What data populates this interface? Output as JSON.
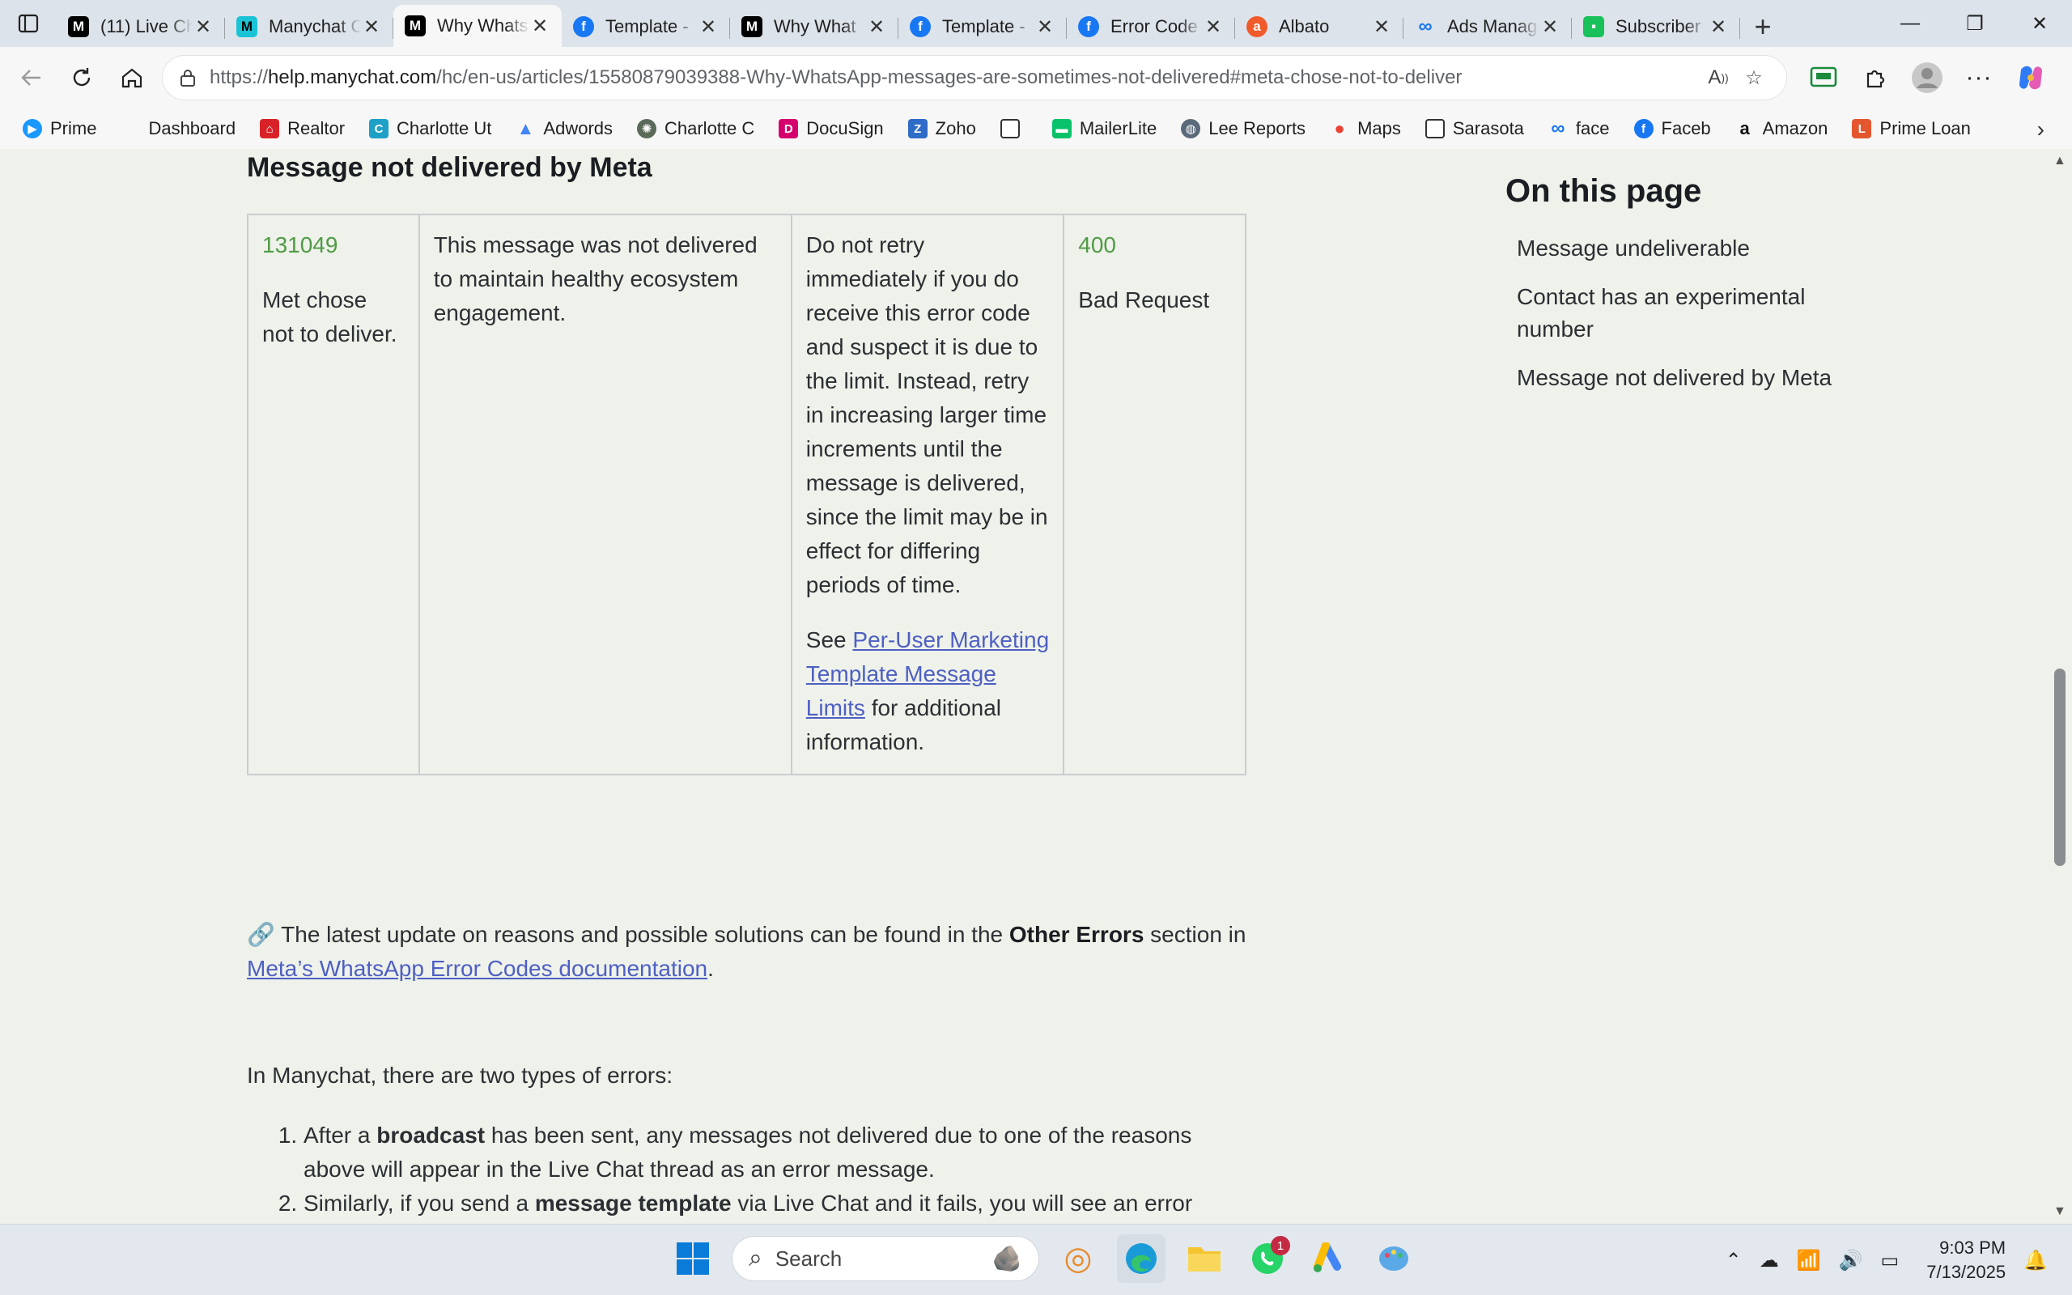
{
  "browser": {
    "tabs": [
      {
        "title": "(11) Live Ch",
        "icon": "manychat-m-icon",
        "active": false
      },
      {
        "title": "Manychat C",
        "icon": "manychat-teal-icon",
        "active": false
      },
      {
        "title": "Why Whats",
        "icon": "manychat-m-icon",
        "active": true
      },
      {
        "title": "Template -",
        "icon": "facebook-icon",
        "active": false
      },
      {
        "title": "Why What",
        "icon": "manychat-m-icon",
        "active": false
      },
      {
        "title": "Template -",
        "icon": "facebook-icon",
        "active": false
      },
      {
        "title": "Error Code",
        "icon": "facebook-icon",
        "active": false
      },
      {
        "title": "Albato",
        "icon": "albato-icon",
        "active": false
      },
      {
        "title": "Ads Manag",
        "icon": "meta-icon",
        "active": false
      },
      {
        "title": "Subscriber",
        "icon": "chat-green-icon",
        "active": false
      }
    ],
    "url_prefix": "https://",
    "url_host": "help.manychat.com",
    "url_path": "/hc/en-us/articles/15580879039388-Why-WhatsApp-messages-are-sometimes-not-delivered#meta-chose-not-to-deliver",
    "bookmarks": [
      {
        "label": "Prime",
        "icon": "prime-icon",
        "color": "#1a98ff"
      },
      {
        "label": "Dashboard",
        "icon": "dashboard-icon",
        "color": "#ffffff"
      },
      {
        "label": "Realtor",
        "icon": "realtor-icon",
        "color": "#d92228"
      },
      {
        "label": "Charlotte Ut",
        "icon": "charlotte-icon",
        "color": "#1fa0c7"
      },
      {
        "label": "Adwords",
        "icon": "adwords-icon",
        "color": "#4285f4"
      },
      {
        "label": "Charlotte C",
        "icon": "seal-icon",
        "color": "#5a6b5a"
      },
      {
        "label": "DocuSign",
        "icon": "docusign-icon",
        "color": "#d5006d"
      },
      {
        "label": "Zoho",
        "icon": "zoho-icon",
        "color": "#2f6cc8"
      },
      {
        "label": "",
        "icon": "page-icon",
        "color": "#ffffff"
      },
      {
        "label": "MailerLite",
        "icon": "mailerlite-icon",
        "color": "#09c269"
      },
      {
        "label": "Lee Reports",
        "icon": "globe-icon",
        "color": "#5b6a7a"
      },
      {
        "label": "Maps",
        "icon": "maps-icon",
        "color": "#34a853"
      },
      {
        "label": "Sarasota",
        "icon": "page-icon",
        "color": "#ffffff"
      },
      {
        "label": "face",
        "icon": "meta-icon",
        "color": "#1877f2"
      },
      {
        "label": "Faceb",
        "icon": "facebook-icon",
        "color": "#1877f2"
      },
      {
        "label": "Amazon",
        "icon": "amazon-icon",
        "color": "#111111"
      },
      {
        "label": "Prime Loan",
        "icon": "primeloan-icon",
        "color": "#e4572e"
      }
    ]
  },
  "article": {
    "section_title": "Message not delivered by Meta",
    "table": {
      "code": "131049",
      "description": "Met chose not to deliver.",
      "message": "This message was not delivered to maintain healthy ecosystem engagement.",
      "solution": "Do not retry immediately if you do receive this error code and suspect it is due to the limit. Instead, retry in increasing larger time increments until the message is delivered, since the limit may be in effect for differing periods of time.",
      "see_prefix": "See ",
      "see_link": "Per-User Marketing Template Message Limits",
      "see_suffix": " for additional information.",
      "http_code": "400",
      "http_text": "Bad Request"
    },
    "note_emoji": "🔗",
    "note_before": " The latest update on reasons and possible solutions can be found in the ",
    "note_bold": "Other Errors",
    "note_mid": " section in ",
    "note_link": "Meta’s WhatsApp Error Codes documentation",
    "note_end": ".",
    "intro": "In Manychat, there are two types of errors:",
    "list": [
      {
        "before": "After a ",
        "bold": "broadcast",
        "after": " has been sent, any messages not delivered due to one of the reasons above will appear in the Live Chat thread as an error message."
      },
      {
        "before": "Similarly, if you send a ",
        "bold": "message template",
        "after": " via Live Chat and it fails, you will see an error"
      }
    ]
  },
  "toc": {
    "title": "On this page",
    "items": [
      "Message undeliverable",
      "Contact has an experimental number",
      "Message not delivered by Meta"
    ]
  },
  "taskbar": {
    "search_label": "Search",
    "whatsapp_badge": "1",
    "time": "9:03 PM",
    "date": "7/13/2025"
  }
}
